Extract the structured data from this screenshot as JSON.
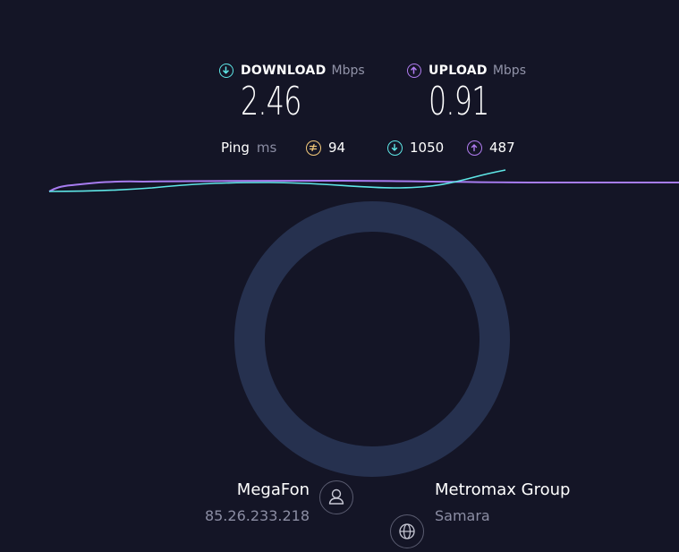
{
  "download": {
    "title": "DOWNLOAD",
    "unit": "Mbps",
    "value": "2.46",
    "icon": "download-arrow-icon",
    "color": "#5ee6e6"
  },
  "upload": {
    "title": "UPLOAD",
    "unit": "Mbps",
    "value": "0.91",
    "icon": "upload-arrow-icon",
    "color": "#b07cf0"
  },
  "ping": {
    "label": "Ping",
    "unit": "ms",
    "idle": {
      "value": "94",
      "icon": "ping-jitter-icon",
      "color": "#f3c97a"
    },
    "download": {
      "value": "1050",
      "icon": "download-arrow-icon"
    },
    "upload": {
      "value": "487",
      "icon": "upload-arrow-icon"
    }
  },
  "provider": {
    "name": "MegaFon",
    "ip": "85.26.233.218",
    "icon": "user-icon"
  },
  "server": {
    "name": "Metromax Group",
    "location": "Samara",
    "icon": "globe-icon"
  }
}
